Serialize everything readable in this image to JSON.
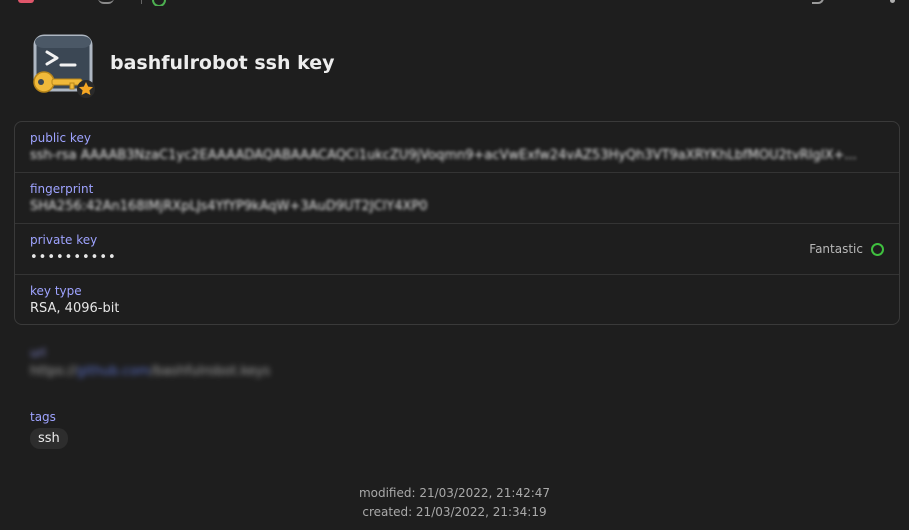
{
  "item": {
    "title": "bashfulrobot ssh key"
  },
  "fields": {
    "public_key": {
      "label": "public key",
      "value": "ssh-rsa AAAAB3NzaC1yc2EAAAADAQABAAACAQCi1ukcZU9jVoqmn9+acVwExfw24vAZ53HyQh3VT9aXRYKhLbfMOU2tvRIgIX+..."
    },
    "fingerprint": {
      "label": "fingerprint",
      "value": "SHA256:42An168IMjRXpLJs4YfYP9kAqW+3AuD9UT2JClY4XP0"
    },
    "private_key": {
      "label": "private key",
      "value": "••••••••••",
      "strength": "Fantastic"
    },
    "key_type": {
      "label": "key type",
      "value": "RSA, 4096-bit"
    }
  },
  "obscured_field": {
    "label": "url",
    "value_prefix": "https://",
    "value_link": "github.com",
    "value_suffix": "/bashfulrobot.keys"
  },
  "tags": {
    "label": "tags",
    "items": [
      "ssh"
    ]
  },
  "meta": {
    "modified": "modified: 21/03/2022, 21:42:47",
    "created": "created: 21/03/2022, 21:34:19"
  },
  "colors": {
    "label_accent": "#9ea3ff",
    "strength_good": "#3fbf3f",
    "background": "#1e1e1e"
  },
  "icons": {
    "item_icon": "terminal-key-favorite-icon",
    "strength_icon": "strength-ring-icon"
  }
}
